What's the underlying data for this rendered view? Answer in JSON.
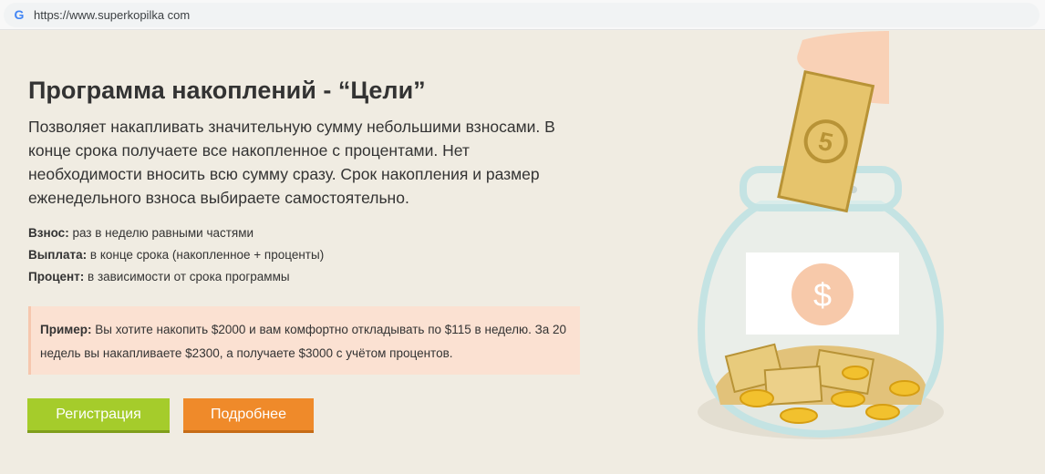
{
  "browser": {
    "url": "https://www.superkopilka com",
    "icon": "google-g-icon"
  },
  "main": {
    "title": "Программа накоплений - “Цели”",
    "description": "Позволяет накапливать значительную сумму небольшими взносами. В конце срока получаете все накопленное с процентами. Нет необходимости вносить всю сумму сразу. Срок накопления и размер еженедельного взноса выбираете самостоятельно.",
    "facts": [
      {
        "label": "Взнос:",
        "value": " раз в неделю равными частями"
      },
      {
        "label": "Выплата:",
        "value": " в конце срока (накопленное + проценты)"
      },
      {
        "label": "Процент:",
        "value": " в зависимости от срока программы"
      }
    ],
    "example": {
      "label": "Пример:",
      "text": " Вы хотите накопить $2000 и вам комфортно откладывать по $115 в неделю. За 20 недель вы накапливаете $2300, а получаете $3000 с учётом процентов."
    },
    "buttons": {
      "register": "Регистрация",
      "more": "Подробнее"
    }
  },
  "illustration": {
    "jar_label_symbol": "$",
    "bill_symbol": "5",
    "colors": {
      "green_button": "#a5cc2b",
      "orange_button": "#ef8a2a",
      "example_bg": "#fbe1d2",
      "page_bg": "#f0ece2"
    }
  }
}
